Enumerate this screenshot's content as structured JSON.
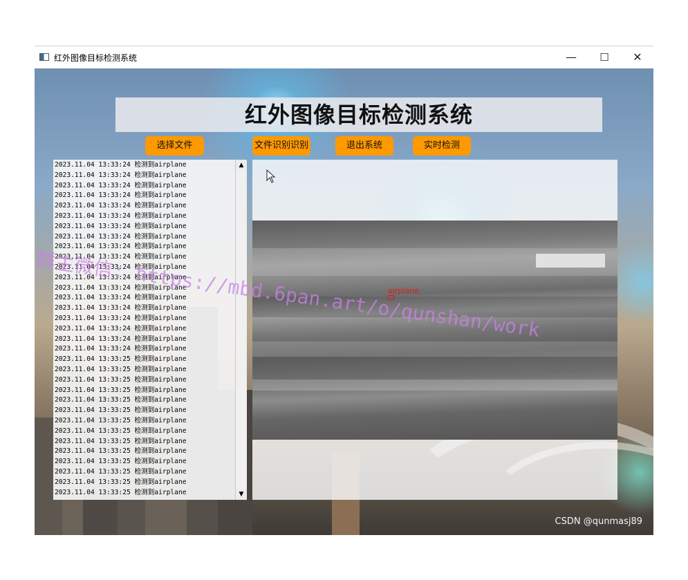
{
  "window": {
    "title": "红外图像目标检测系统",
    "minimize": "—",
    "maximize": "☐",
    "close": "✕"
  },
  "header": {
    "title": "红外图像目标检测系统"
  },
  "toolbar": {
    "select_file": "选择文件",
    "file_recognize": "文件识别识别",
    "exit": "退出系统",
    "realtime": "实时检测"
  },
  "log": {
    "entries": [
      "2023.11.04 13:33:24 检测到airplane",
      "2023.11.04 13:33:24 检测到airplane",
      "2023.11.04 13:33:24 检测到airplane",
      "2023.11.04 13:33:24 检测到airplane",
      "2023.11.04 13:33:24 检测到airplane",
      "2023.11.04 13:33:24 检测到airplane",
      "2023.11.04 13:33:24 检测到airplane",
      "2023.11.04 13:33:24 检测到airplane",
      "2023.11.04 13:33:24 检测到airplane",
      "2023.11.04 13:33:24 检测到airplane",
      "2023.11.04 13:33:24 检测到airplane",
      "2023.11.04 13:33:24 检测到airplane",
      "2023.11.04 13:33:24 检测到airplane",
      "2023.11.04 13:33:24 检测到airplane",
      "2023.11.04 13:33:24 检测到airplane",
      "2023.11.04 13:33:24 检测到airplane",
      "2023.11.04 13:33:24 检测到airplane",
      "2023.11.04 13:33:24 检测到airplane",
      "2023.11.04 13:33:24 检测到airplane",
      "2023.11.04 13:33:25 检测到airplane",
      "2023.11.04 13:33:25 检测到airplane",
      "2023.11.04 13:33:25 检测到airplane",
      "2023.11.04 13:33:25 检测到airplane",
      "2023.11.04 13:33:25 检测到airplane",
      "2023.11.04 13:33:25 检测到airplane",
      "2023.11.04 13:33:25 检测到airplane",
      "2023.11.04 13:33:25 检测到airplane",
      "2023.11.04 13:33:25 检测到airplane",
      "2023.11.04 13:33:25 检测到airplane",
      "2023.11.04 13:33:25 检测到airplane",
      "2023.11.04 13:33:25 检测到airplane",
      "2023.11.04 13:33:25 检测到airplane",
      "2023.11.04 13:33:25 检测到airplane"
    ],
    "scroll_up": "▲",
    "scroll_down": "▼"
  },
  "viewer": {
    "detection_label": "airplane",
    "detection_color": "#e01818"
  },
  "overlay": {
    "watermark": "群主微信:  https://mbd.6pan.art/o/qunshan/work",
    "csdn": "CSDN @qunmasj89"
  },
  "colors": {
    "button": "#ff9900"
  }
}
